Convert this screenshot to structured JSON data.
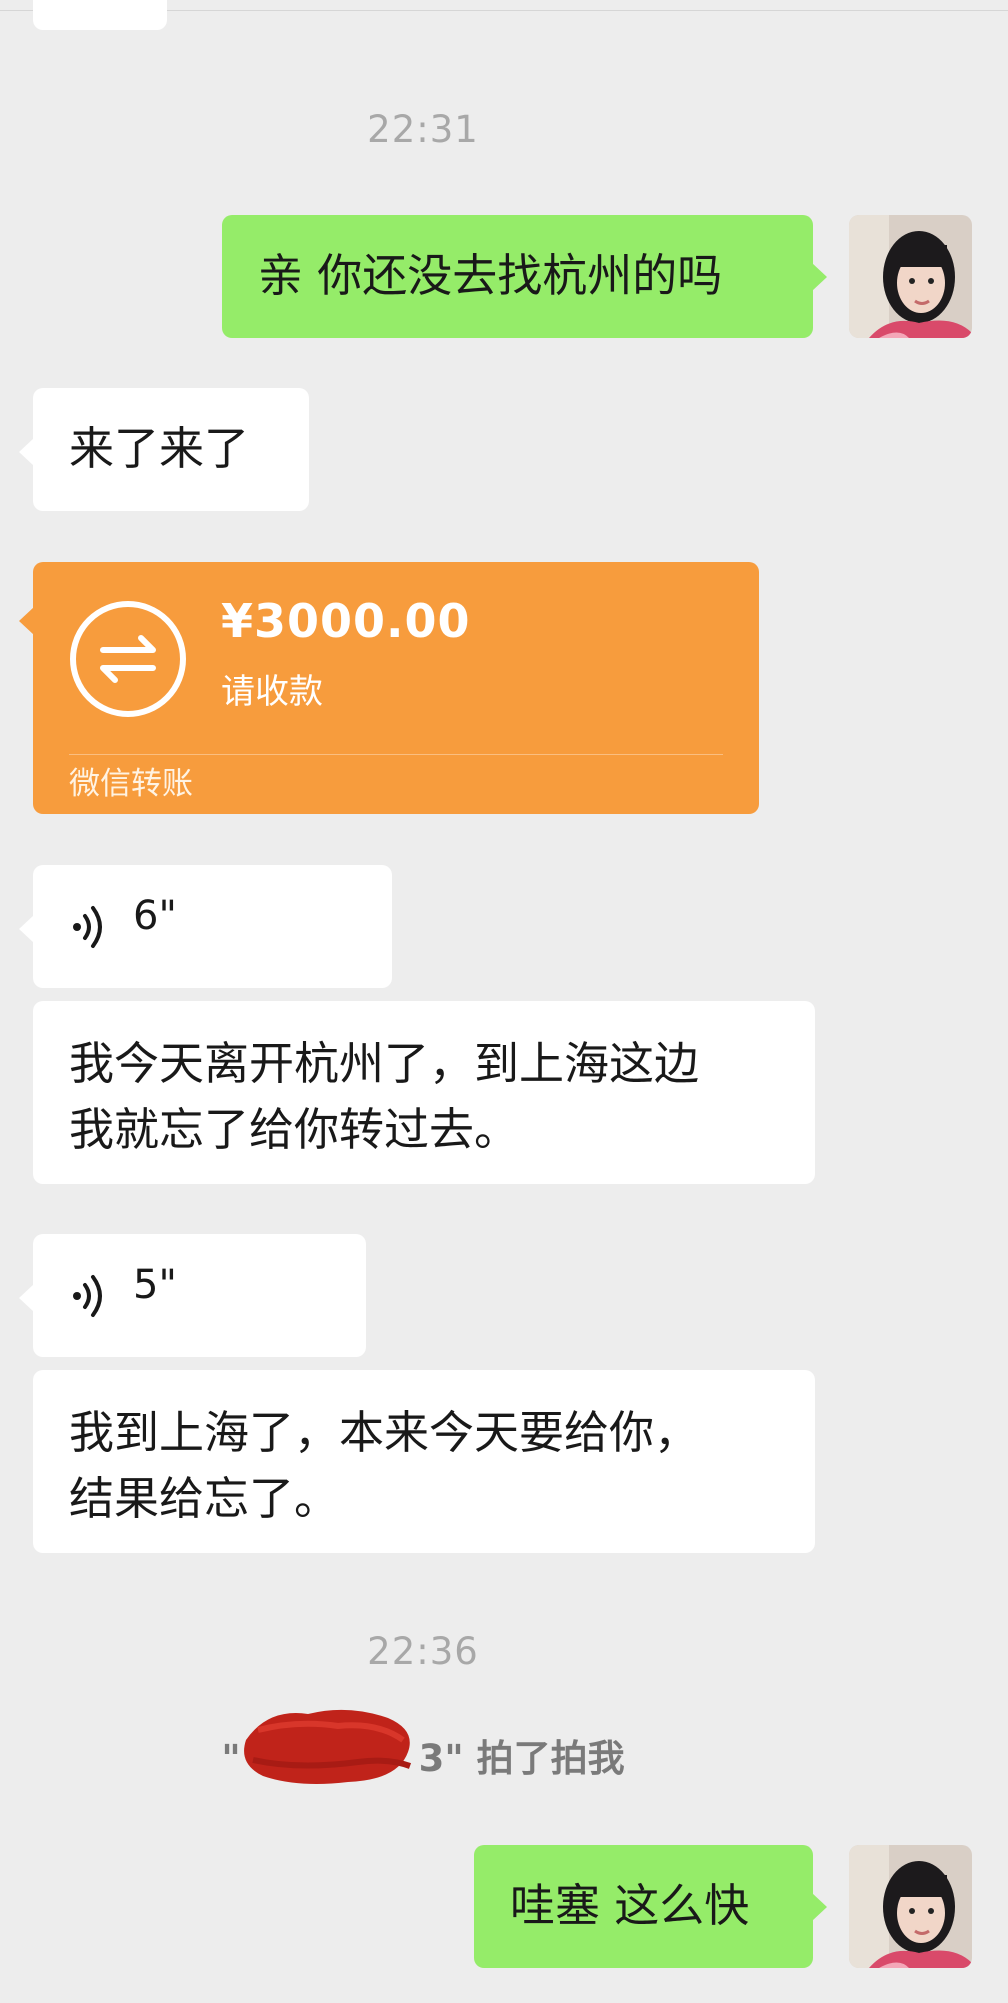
{
  "chat": {
    "timestamp_1": "22:31",
    "timestamp_2": "22:36",
    "messages": {
      "out_1": "亲 你还没去找杭州的吗",
      "in_1": "来了来了",
      "transfer": {
        "amount": "¥3000.00",
        "status": "请收款",
        "footer": "微信转账",
        "icon": "transfer-arrows-icon"
      },
      "voice_1": {
        "duration": "6\"",
        "icon": "voice-wave-icon"
      },
      "in_2": "我今天离开杭州了，到上海这边\n我就忘了给你转过去。",
      "voice_2": {
        "duration": "5\"",
        "icon": "voice-wave-icon"
      },
      "in_3": "我到上海了，本来今天要给你，\n结果给忘了。",
      "out_2": "哇塞 这么快"
    },
    "system_pat": {
      "quote_open": "\"",
      "quote_tail": "3\"",
      "text": "拍了拍我"
    }
  },
  "colors": {
    "background": "#ededed",
    "outgoing_bubble": "#95ec69",
    "incoming_bubble": "#ffffff",
    "transfer_card": "#f79c3d",
    "timestamp_text": "#a8a8a8",
    "redaction": "#c0231a"
  }
}
